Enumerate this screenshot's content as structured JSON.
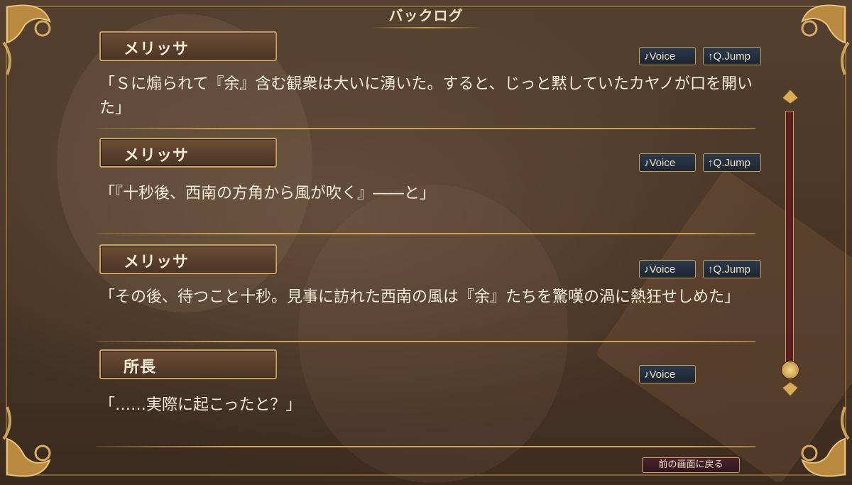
{
  "screen": {
    "title": "バックログ"
  },
  "entries": [
    {
      "speaker": "メリッサ",
      "text": "「Ｓに煽られて『余』含む観衆は大いに湧いた。すると、じっと黙していたカヤノが口を開いた」",
      "voice_label": "♪Voice",
      "jump_label": "↑Q.Jump"
    },
    {
      "speaker": "メリッサ",
      "text": "「『十秒後、西南の方角から風が吹く』――と」",
      "voice_label": "♪Voice",
      "jump_label": "↑Q.Jump"
    },
    {
      "speaker": "メリッサ",
      "text": "「その後、待つこと十秒。見事に訪れた西南の風は『余』たちを驚嘆の渦に熱狂せしめた」",
      "voice_label": "♪Voice",
      "jump_label": "↑Q.Jump"
    },
    {
      "speaker": "所長",
      "text": "「……実際に起こったと？」",
      "voice_label": "♪Voice"
    }
  ],
  "footer": {
    "back_label": "前の画面に戻る"
  },
  "colors": {
    "gold": "#c9a35a",
    "scroll_track": "#5a1e22",
    "button_bg": "#1c2633"
  }
}
